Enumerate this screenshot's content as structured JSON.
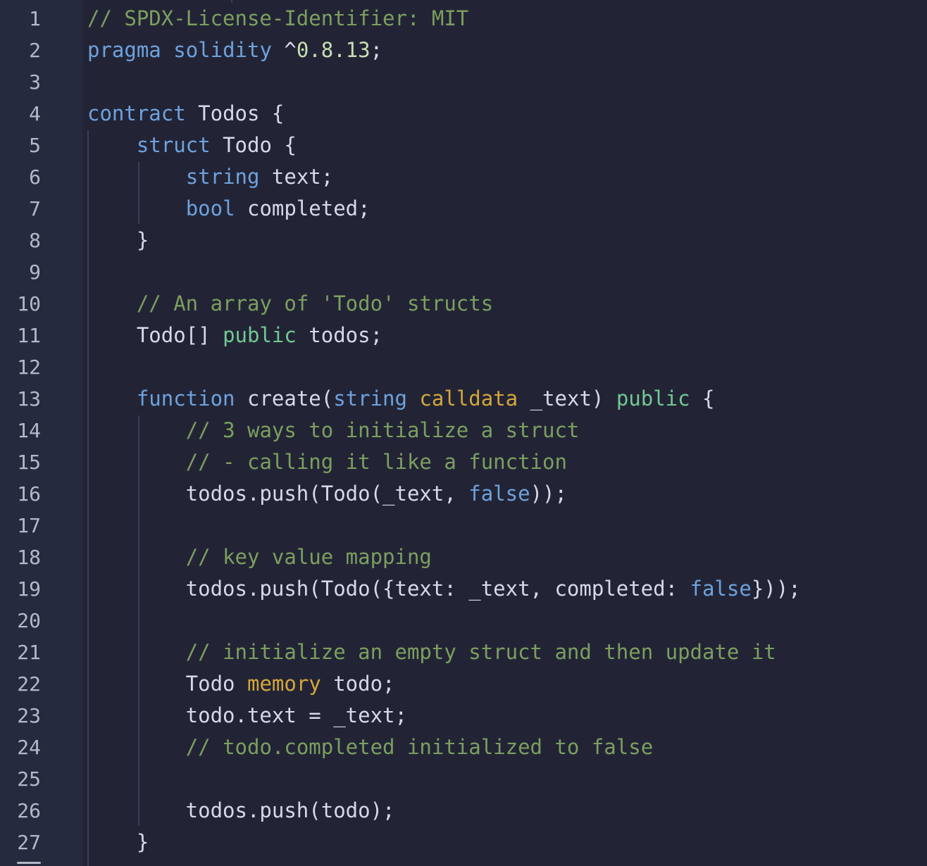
{
  "editor": {
    "language": "solidity",
    "colors": {
      "background": "#222436",
      "gutter": "#262a3e",
      "line_number": "#b4b9c9",
      "comment": "#7c9f5e",
      "keyword": "#6ea2dd",
      "modifier": "#73c991",
      "storage": "#d4a738",
      "number": "#c8dfb2",
      "text": "#d6dae8"
    },
    "line_numbers": [
      "1",
      "2",
      "3",
      "4",
      "5",
      "6",
      "7",
      "8",
      "9",
      "10",
      "11",
      "12",
      "13",
      "14",
      "15",
      "16",
      "17",
      "18",
      "19",
      "20",
      "21",
      "22",
      "23",
      "24",
      "25",
      "26",
      "27"
    ],
    "lines": [
      [
        {
          "t": "// SPDX-License-Identifier: MIT",
          "k": "comment"
        }
      ],
      [
        {
          "t": "pragma",
          "k": "keyword"
        },
        {
          "t": " "
        },
        {
          "t": "solidity",
          "k": "keyword"
        },
        {
          "t": " ^"
        },
        {
          "t": "0.8.13",
          "k": "number"
        },
        {
          "t": ";"
        }
      ],
      [],
      [
        {
          "t": "contract",
          "k": "keyword"
        },
        {
          "t": " Todos {"
        }
      ],
      [
        {
          "t": "    "
        },
        {
          "t": "struct",
          "k": "keyword"
        },
        {
          "t": " Todo {"
        }
      ],
      [
        {
          "t": "        "
        },
        {
          "t": "string",
          "k": "type"
        },
        {
          "t": " text;"
        }
      ],
      [
        {
          "t": "        "
        },
        {
          "t": "bool",
          "k": "type"
        },
        {
          "t": " completed;"
        }
      ],
      [
        {
          "t": "    }"
        }
      ],
      [],
      [
        {
          "t": "    "
        },
        {
          "t": "// An array of 'Todo' structs",
          "k": "comment"
        }
      ],
      [
        {
          "t": "    Todo[] "
        },
        {
          "t": "public",
          "k": "modifier"
        },
        {
          "t": " todos;"
        }
      ],
      [],
      [
        {
          "t": "    "
        },
        {
          "t": "function",
          "k": "keyword"
        },
        {
          "t": " create("
        },
        {
          "t": "string",
          "k": "type"
        },
        {
          "t": " "
        },
        {
          "t": "calldata",
          "k": "storage"
        },
        {
          "t": " _text) "
        },
        {
          "t": "public",
          "k": "modifier"
        },
        {
          "t": " {"
        }
      ],
      [
        {
          "t": "        "
        },
        {
          "t": "// 3 ways to initialize a struct",
          "k": "comment"
        }
      ],
      [
        {
          "t": "        "
        },
        {
          "t": "// - calling it like a function",
          "k": "comment"
        }
      ],
      [
        {
          "t": "        todos.push(Todo(_text, "
        },
        {
          "t": "false",
          "k": "literal"
        },
        {
          "t": "));"
        }
      ],
      [],
      [
        {
          "t": "        "
        },
        {
          "t": "// key value mapping",
          "k": "comment"
        }
      ],
      [
        {
          "t": "        todos.push(Todo({text: _text, completed: "
        },
        {
          "t": "false",
          "k": "literal"
        },
        {
          "t": "}));"
        }
      ],
      [],
      [
        {
          "t": "        "
        },
        {
          "t": "// initialize an empty struct and then update it",
          "k": "comment"
        }
      ],
      [
        {
          "t": "        Todo "
        },
        {
          "t": "memory",
          "k": "storage"
        },
        {
          "t": " todo;"
        }
      ],
      [
        {
          "t": "        todo.text = _text;"
        }
      ],
      [
        {
          "t": "        "
        },
        {
          "t": "// todo.completed initialized to false",
          "k": "comment"
        }
      ],
      [],
      [
        {
          "t": "        todos.push(todo);"
        }
      ],
      [
        {
          "t": "    }"
        }
      ]
    ]
  }
}
